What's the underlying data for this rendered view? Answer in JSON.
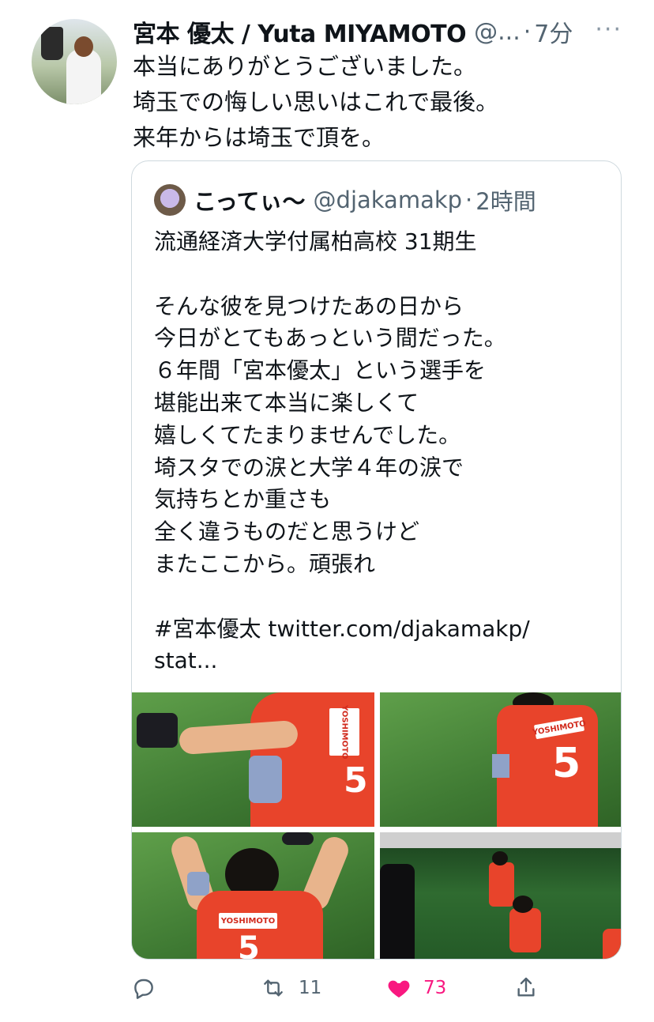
{
  "tweet": {
    "author_name": "宮本 優太 / Yuta MIYAMOTO",
    "handle": "@...",
    "separator": "·",
    "time": "7分",
    "more": "···",
    "text_lines": [
      "本当にありがとうございました。",
      "埼玉での悔しい思いはこれで最後。",
      "来年からは埼玉で頂を。"
    ]
  },
  "quote": {
    "name": "こってぃ～",
    "handle": "@djakamakp",
    "separator": "·",
    "time": "2時間",
    "body_lines": [
      "流通経済大学付属柏高校 31期生",
      "",
      "そんな彼を見つけたあの日から",
      "今日がとてもあっという間だった。",
      "６年間「宮本優太」という選手を",
      "堪能出来て本当に楽しくて",
      "嬉しくてたまりませんでした。",
      "埼スタでの涙と大学４年の涙で",
      "気持ちとか重さも",
      "全く違うものだと思うけど",
      "またここから。頑張れ",
      "",
      " #宮本優太 twitter.com/djakamakp/",
      "stat..."
    ],
    "photos": [
      {
        "sponsor": "YOSHIMOTO",
        "number": "5"
      },
      {
        "sponsor": "YOSHIMOTO",
        "number": "5"
      },
      {
        "sponsor": "YOSHIMOTO",
        "number": "5"
      },
      {
        "sponsor": "",
        "number": ""
      }
    ]
  },
  "actions": {
    "reply_count": "",
    "retweet_count": "11",
    "like_count": "73",
    "like_color": "#f91880"
  },
  "icons": [
    "reply-icon",
    "retweet-icon",
    "heart-icon",
    "share-icon",
    "more-icon"
  ]
}
